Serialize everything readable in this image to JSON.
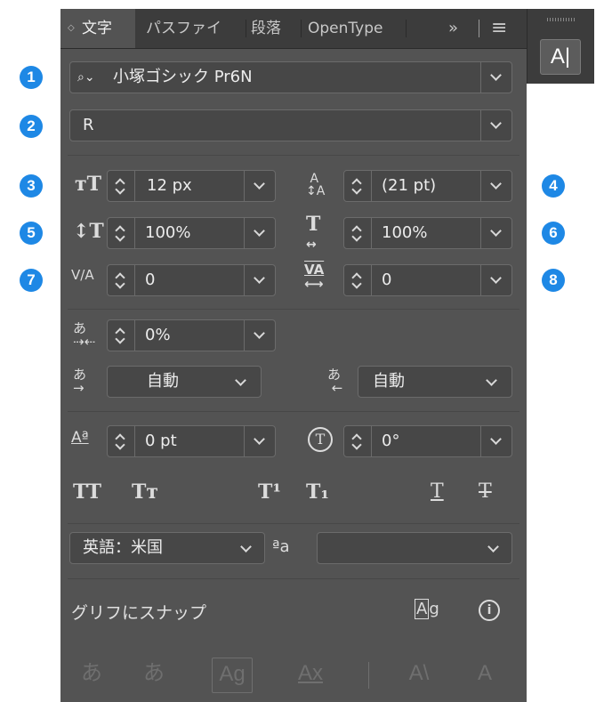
{
  "tabs": [
    {
      "label": "文字",
      "active": true
    },
    {
      "label": "パスファイ",
      "active": false
    },
    {
      "label": "段落",
      "active": false
    },
    {
      "label": "OpenType",
      "active": false
    }
  ],
  "tab_more": "»",
  "tab_menu": "≡",
  "font": {
    "family": "小塚ゴシック Pr6N",
    "style": "R"
  },
  "size": "12 px",
  "leading": "(21 pt)",
  "vertical_scale": "100%",
  "horizontal_scale": "100%",
  "kerning": "0",
  "tracking": "0",
  "tsume": "0%",
  "aki_left": "自動",
  "aki_right": "自動",
  "baseline_shift": "0 pt",
  "rotation": "0°",
  "language": "英語：米国",
  "antialias_label": "ªa",
  "antialias": "",
  "glyph_snap": "グリフにスナップ",
  "badges": [
    "1",
    "2",
    "3",
    "4",
    "5",
    "6",
    "7",
    "8"
  ],
  "format_buttons": [
    "TT",
    "Tт",
    "T¹",
    "T₁",
    "T",
    "T"
  ],
  "bottom_buttons": [
    "あ",
    "あ",
    "Ag",
    "Ax",
    "A\\",
    "A"
  ],
  "side_panel": {
    "label": "A|"
  },
  "icons": {
    "size_icon": "tT",
    "vscale_icon": "↕T",
    "kern_icon": "V/A",
    "tsume_icon": "あ",
    "baseline_icon": "Aª",
    "rotate_icon": "T",
    "glyph_icon": "Ag",
    "info_icon": "i",
    "search_icon": "Q"
  },
  "colors": {
    "panel": "#535353",
    "tabbar": "#3c3c3c",
    "badge": "#1e88e5"
  }
}
